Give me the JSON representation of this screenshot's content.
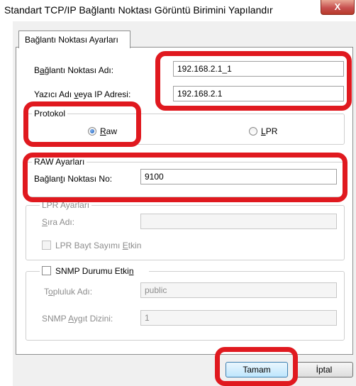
{
  "window": {
    "title": "Standart TCP/IP Bağlantı Noktası Görüntü Birimini Yapılandır",
    "close_glyph": "X"
  },
  "tab": {
    "label": "Bağlantı Noktası Ayarları"
  },
  "port": {
    "name_label_pre": "B",
    "name_label_ul": "a",
    "name_label_post": "ğlantı Noktası Adı:",
    "name_value": "192.168.2.1_1",
    "printer_label_pre": "Yazıcı Adı ",
    "printer_label_ul": "v",
    "printer_label_post": "eya IP Adresi:",
    "printer_value": "192.168.2.1"
  },
  "protocol": {
    "legend": "Protokol",
    "raw_ul": "R",
    "raw_post": "aw",
    "lpr_ul": "L",
    "lpr_post": "PR",
    "selected": "Raw"
  },
  "raw_settings": {
    "legend": "RAW Ayarları",
    "port_number_pre": "Bağlan",
    "port_number_ul": "t",
    "port_number_post": "ı Noktası No:",
    "port_number_value": "9100"
  },
  "lpr_settings": {
    "legend": "LPR Ayarları",
    "queue_label_ul": "S",
    "queue_label_post": "ıra Adı:",
    "queue_value": "",
    "byte_count_pre": "LPR Bayt Sayımı ",
    "byte_count_ul": "E",
    "byte_count_post": "tkin",
    "byte_count_checked": false
  },
  "snmp": {
    "checkbox_pre": "SNMP Durumu Etki",
    "checkbox_ul": "n",
    "checked": false,
    "community_pre": "T",
    "community_ul": "o",
    "community_post": "pluluk Adı:",
    "community_value": "public",
    "device_index_pre": "SNMP ",
    "device_index_ul": "A",
    "device_index_post": "ygıt Dizini:",
    "device_index_value": "1"
  },
  "buttons": {
    "ok": "Tamam",
    "cancel": "İptal"
  },
  "colors": {
    "highlight": "#e0191f",
    "accent": "#3c7fb1"
  }
}
